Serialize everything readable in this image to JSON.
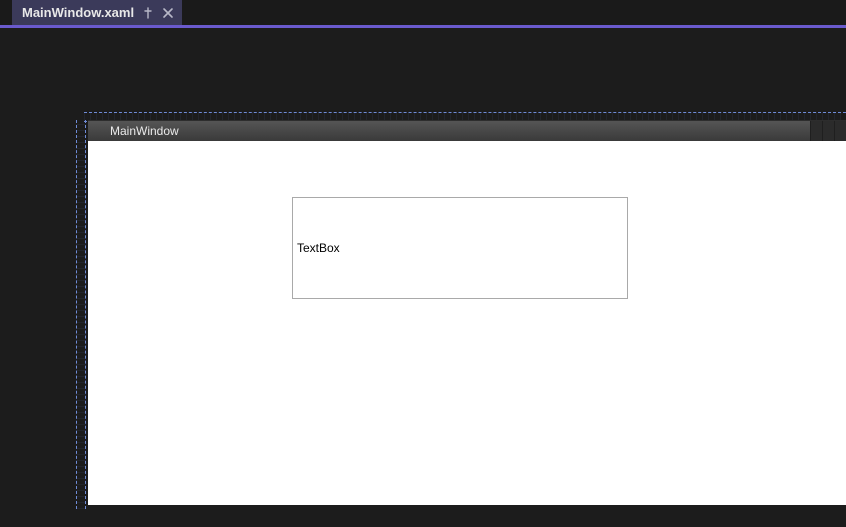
{
  "tab": {
    "label": "MainWindow.xaml"
  },
  "preview": {
    "window_title": "MainWindow",
    "textbox_value": "TextBox"
  }
}
